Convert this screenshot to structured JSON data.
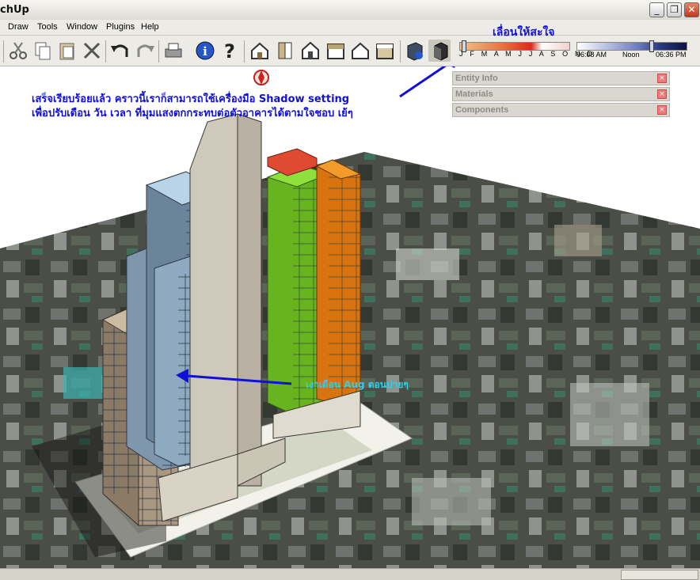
{
  "window": {
    "title": "chUp",
    "minimize": "_",
    "restore": "❐",
    "close": "✕"
  },
  "menu": [
    "Draw",
    "Tools",
    "Window",
    "Plugins",
    "Help"
  ],
  "toolbar": {
    "icons": [
      "scissors-icon",
      "copy-icon",
      "paste-icon",
      "erase-icon",
      "undo-icon",
      "redo-icon",
      "print-icon",
      "info-icon",
      "help-icon",
      "iso-view-icon",
      "top-view-icon",
      "front-view-icon",
      "right-view-icon",
      "back-view-icon",
      "left-view-icon",
      "shadow-settings-icon",
      "shadow-toggle-icon"
    ]
  },
  "shadow_slider": {
    "months": "J F M A M J J A S O N D",
    "time_start": "06:08 AM",
    "time_mid": "Noon",
    "time_end": "06:36 PM"
  },
  "trays": [
    "Entity Info",
    "Materials",
    "Components"
  ],
  "annotations": {
    "drag_note": "เลื่อนให้สะใจ",
    "line1": "เสร็จเรียบร้อยแล้ว คราวนี้เราก็สามารถใช้เครื่องมือ Shadow setting",
    "line2": "เพื่อปรับเดือน วัน เวลา ที่มุมแสงตกกระทบต่อตัวอาคารได้ตามใจชอบ เย้ๆ",
    "shadow_note": "เงาเดือน Aug ตอนบ่ายๆ"
  },
  "colors": {
    "annotation_blue": "#1010d8",
    "annotation_cyan": "#30d0e8",
    "accent_orange": "#e07a10",
    "accent_green": "#7cd020"
  }
}
